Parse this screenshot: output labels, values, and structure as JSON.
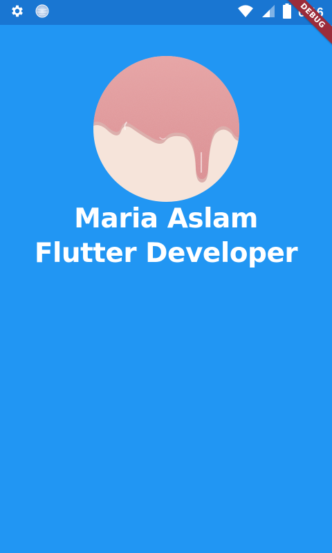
{
  "status_bar": {
    "time": "6:16",
    "icons": [
      "gear-icon",
      "globe-icon",
      "wifi-icon",
      "cellular-signal-icon",
      "battery-icon"
    ],
    "bar_color": "#1976d2"
  },
  "debug_banner": {
    "label": "DEBUG",
    "color": "#9b2c3a"
  },
  "profile": {
    "name": "Maria Aslam",
    "title": "Flutter Developer",
    "avatar_image": "pink-dripping-glitter-image"
  },
  "theme": {
    "background": "#2196f3",
    "text": "#ffffff"
  }
}
